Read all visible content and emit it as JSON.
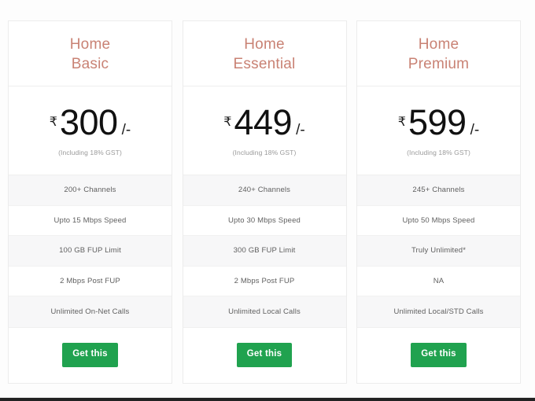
{
  "page": {
    "background_color": "#fdfdfd",
    "accent_heading_color": "#c98274",
    "cta_color": "#20a24f",
    "row_shade_color": "#f7f7f8"
  },
  "plans": [
    {
      "name_line_1": "Home",
      "name_line_2": "Basic",
      "currency_symbol": "₹",
      "price": "300",
      "price_suffix": "/-",
      "price_note": "(Including 18% GST)",
      "features": [
        "200+ Channels",
        "Upto 15 Mbps Speed",
        "100 GB FUP Limit",
        "2 Mbps Post FUP",
        "Unlimited On-Net Calls"
      ],
      "cta_label": "Get this"
    },
    {
      "name_line_1": "Home",
      "name_line_2": "Essential",
      "currency_symbol": "₹",
      "price": "449",
      "price_suffix": "/-",
      "price_note": "(Including 18% GST)",
      "features": [
        "240+ Channels",
        "Upto 30 Mbps Speed",
        "300 GB FUP Limit",
        "2 Mbps Post FUP",
        "Unlimited Local Calls"
      ],
      "cta_label": "Get this"
    },
    {
      "name_line_1": "Home",
      "name_line_2": "Premium",
      "currency_symbol": "₹",
      "price": "599",
      "price_suffix": "/-",
      "price_note": "(Including 18% GST)",
      "features": [
        "245+ Channels",
        "Upto 50 Mbps Speed",
        "Truly Unlimited*",
        "NA",
        "Unlimited Local/STD Calls"
      ],
      "cta_label": "Get this"
    }
  ]
}
